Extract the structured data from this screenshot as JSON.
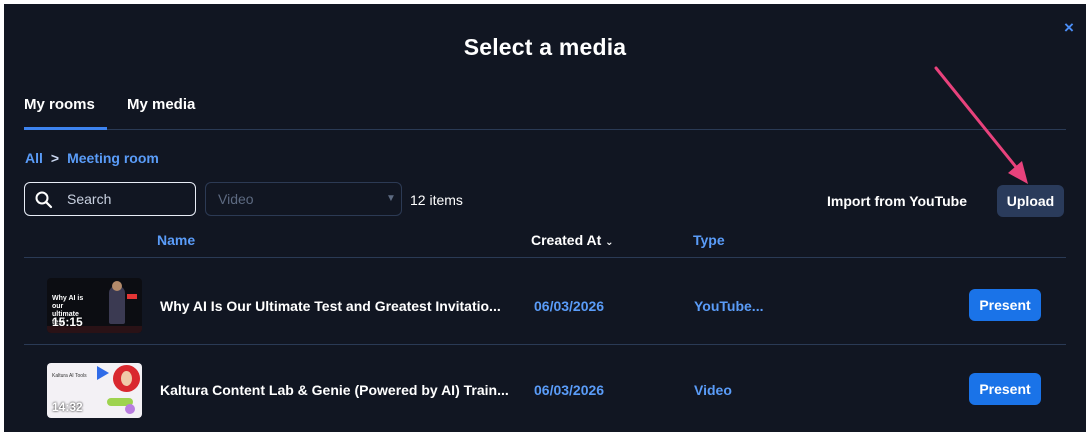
{
  "dialog": {
    "title": "Select a media",
    "close_label": "×"
  },
  "tabs": [
    {
      "label": "My rooms",
      "active": true
    },
    {
      "label": "My media",
      "active": false
    }
  ],
  "breadcrumb": {
    "root": "All",
    "separator": ">",
    "current": "Meeting room"
  },
  "toolbar": {
    "search_placeholder": "Search",
    "filter_value": "Video",
    "item_count": "12 items",
    "import_label": "Import from YouTube",
    "upload_label": "Upload"
  },
  "table": {
    "columns": {
      "name": "Name",
      "created_at": "Created At",
      "type": "Type"
    },
    "rows": [
      {
        "thumb_title": "Why AI is our ultimate test",
        "duration": "15:15",
        "name": "Why AI Is Our Ultimate Test and Greatest Invitatio...",
        "created_at": "06/03/2026",
        "type": "YouTube...",
        "action": "Present"
      },
      {
        "thumb_title": "Kaltura AI Tools",
        "duration": "14:32",
        "name": "Kaltura Content Lab & Genie (Powered by AI) Train...",
        "created_at": "06/03/2026",
        "type": "Video",
        "action": "Present"
      }
    ]
  },
  "colors": {
    "background": "#111622",
    "accent": "#1a73e8",
    "link": "#5a9cf8",
    "annotation_arrow": "#e8427c"
  }
}
